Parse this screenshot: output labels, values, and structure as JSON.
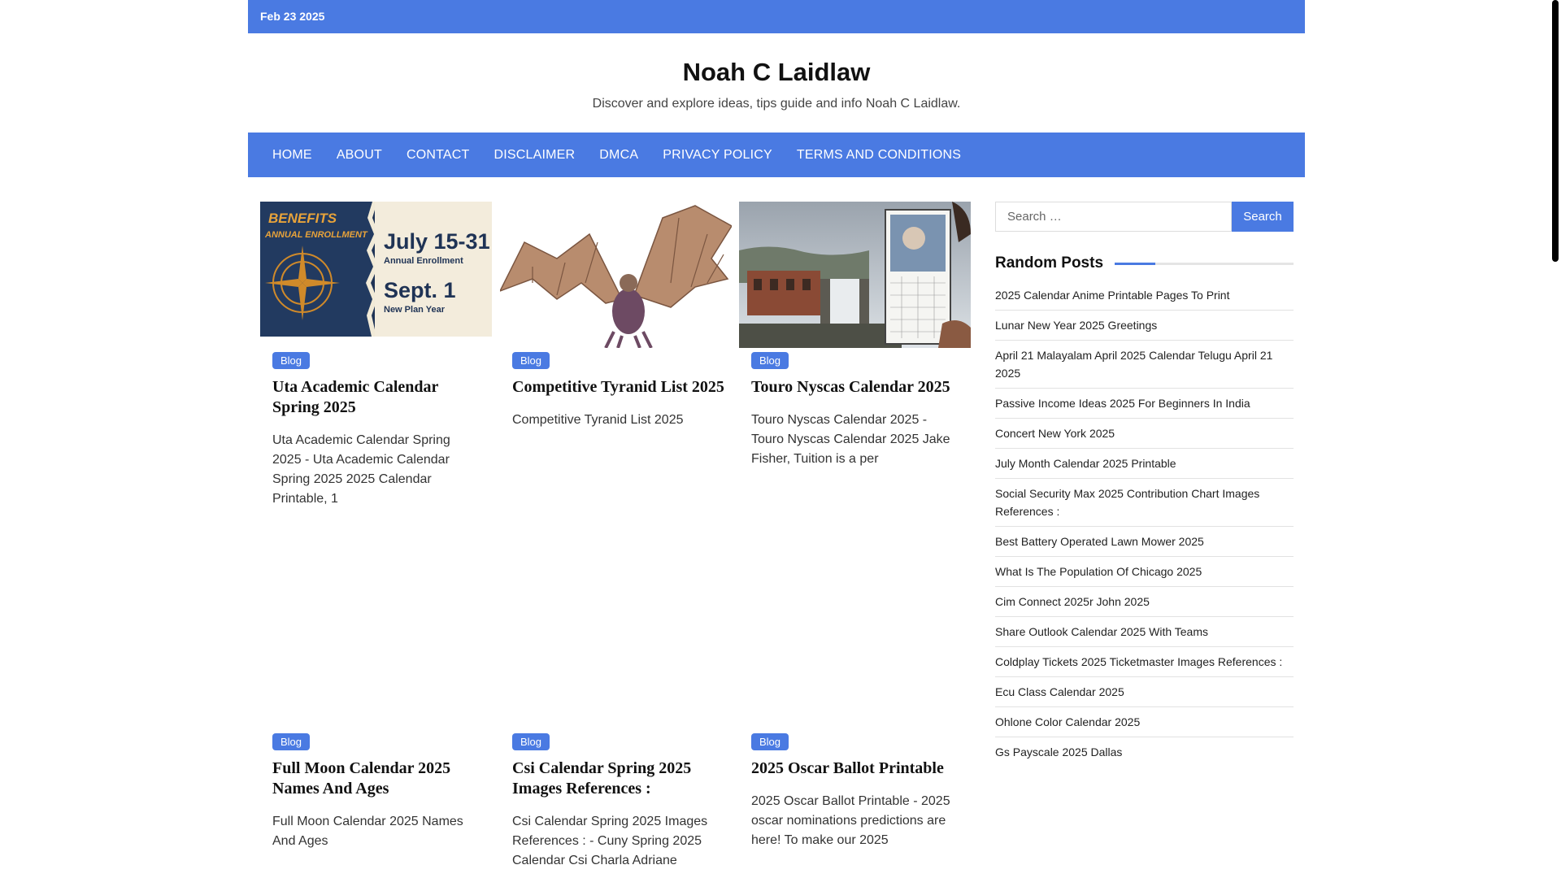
{
  "topbar": {
    "date": "Feb 23 2025"
  },
  "site": {
    "title": "Noah C Laidlaw",
    "tagline": "Discover and explore ideas, tips guide and info Noah C Laidlaw."
  },
  "nav": [
    "HOME",
    "ABOUT",
    "CONTACT",
    "DISCLAIMER",
    "DMCA",
    "PRIVACY POLICY",
    "TERMS AND CONDITIONS"
  ],
  "thumb1": {
    "banner_line1": "BENEFITS",
    "banner_line2": "ANNUAL ENROLLMENT",
    "date1": "July 15-31",
    "sub1": "Annual Enrollment",
    "date2": "Sept. 1",
    "sub2": "New Plan Year"
  },
  "posts": [
    {
      "tag": "Blog",
      "title": "Uta Academic Calendar Spring 2025",
      "excerpt": "Uta Academic Calendar Spring 2025 - Uta Academic Calendar Spring 2025 2025 Calendar Printable, 1"
    },
    {
      "tag": "Blog",
      "title": "Competitive Tyranid List 2025",
      "excerpt": "Competitive Tyranid List 2025"
    },
    {
      "tag": "Blog",
      "title": "Touro Nyscas Calendar 2025",
      "excerpt": "Touro Nyscas Calendar 2025 - Touro Nyscas Calendar 2025 Jake Fisher, Tuition is a per"
    },
    {
      "tag": "Blog",
      "title": "Full Moon Calendar 2025 Names And Ages",
      "excerpt": "Full Moon Calendar 2025 Names And Ages"
    },
    {
      "tag": "Blog",
      "title": "Csi Calendar Spring 2025 Images References :",
      "excerpt": "Csi Calendar Spring 2025 Images References : - Cuny Spring 2025 Calendar Csi Charla Adriane"
    },
    {
      "tag": "Blog",
      "title": "2025 Oscar Ballot Printable",
      "excerpt": "2025 Oscar Ballot Printable - 2025 oscar nominations predictions are here! To make our 2025"
    }
  ],
  "sidebar": {
    "search_placeholder": "Search …",
    "search_button": "Search",
    "random_title": "Random Posts",
    "random_posts": [
      "2025 Calendar Anime Printable Pages To Print",
      "Lunar New Year 2025 Greetings",
      "April 21 Malayalam April 2025 Calendar Telugu April 21 2025",
      "Passive Income Ideas 2025 For Beginners In India",
      "Concert New York 2025",
      "July Month Calendar 2025 Printable",
      "Social Security Max 2025 Contribution Chart Images References :",
      "Best Battery Operated Lawn Mower 2025",
      "What Is The Population Of Chicago 2025",
      "Cim Connect 2025r John 2025",
      "Share Outlook Calendar 2025 With Teams",
      "Coldplay Tickets 2025 Ticketmaster Images References :",
      "Ecu Class Calendar 2025",
      "Ohlone Color Calendar 2025",
      "Gs Payscale 2025 Dallas"
    ]
  },
  "colors": {
    "accent": "#4a7ae2"
  }
}
